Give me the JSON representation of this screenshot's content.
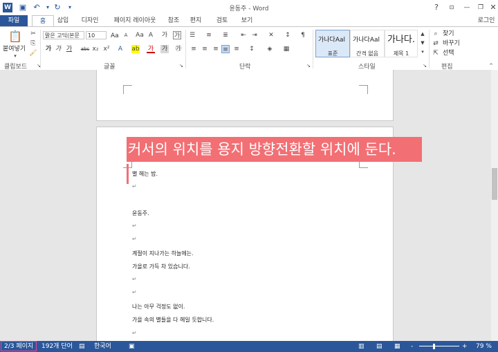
{
  "titlebar": {
    "title": "윤동주 - Word",
    "help": "?",
    "minimize": "—",
    "restore": "❐",
    "close": "✕",
    "app_icon": "W",
    "save_icon": "💾",
    "undo_icon": "↶",
    "redo_icon": "↻",
    "customize_icon": "▾"
  },
  "tabs": {
    "file": "파일",
    "home": "홈",
    "insert": "삽입",
    "design": "디자인",
    "layout": "페이지 레이아웃",
    "references": "참조",
    "mailings": "편지",
    "review": "검토",
    "view": "보기",
    "login": "로그인"
  },
  "ribbon": {
    "clipboard": {
      "paste": "붙여넣기",
      "label": "클립보드"
    },
    "font": {
      "name": "맑은 고딕(본문",
      "size": "10",
      "label": "글꼴",
      "grow": "Aa",
      "bold": "가",
      "italic": "가",
      "underline": "가",
      "strike": "abc",
      "sub": "x₂",
      "sup": "x²"
    },
    "paragraph": {
      "label": "단락"
    },
    "styles": {
      "label": "스타일",
      "items": [
        {
          "sample": "가나다Aal",
          "name": "표준"
        },
        {
          "sample": "가나다Aal",
          "name": "간격 없음"
        },
        {
          "sample": "가나다.",
          "name": "제목 1"
        }
      ]
    },
    "editing": {
      "find": "찾기",
      "replace": "바꾸기",
      "select": "선택",
      "label": "편집"
    }
  },
  "document": {
    "callout": "커서의 위치를 용지 방향전환할 위치에 둔다.",
    "lines": [
      {
        "text": "별 헤는 밤."
      },
      {
        "text": "↵"
      },
      {
        "text": "윤동주."
      },
      {
        "text": "↵"
      },
      {
        "text": "↵"
      },
      {
        "text": "계절이 지나가는 하늘에는."
      },
      {
        "text": "가을로 가득 차 있습니다."
      },
      {
        "text": "↵"
      },
      {
        "text": "↵"
      },
      {
        "text": "나는 아무 걱정도 없이."
      },
      {
        "text": "가을 속의 별들을 다 헤일 듯합니다."
      },
      {
        "text": "↵"
      }
    ]
  },
  "status": {
    "page": "2/3 페이지",
    "words": "192개 단어",
    "language": "한국어",
    "zoom": "79 %",
    "zoom_minus": "-",
    "zoom_plus": "+"
  },
  "colors": {
    "accent": "#2b579a",
    "callout": "#f26f74",
    "highlight_border": "#e04a9a"
  }
}
